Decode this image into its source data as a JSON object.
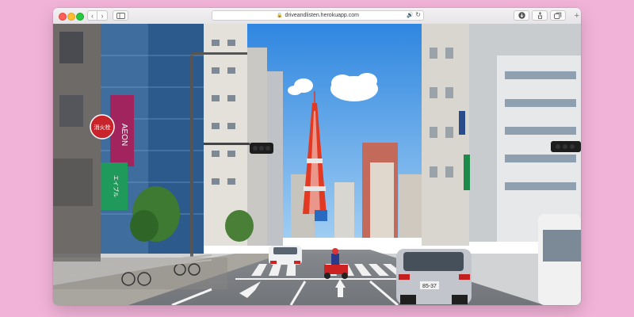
{
  "browser": {
    "url": "driveandlisten.herokuapp.com",
    "back_glyph": "‹",
    "forward_glyph": "›",
    "new_tab_glyph": "+"
  },
  "icons": [
    "close-icon",
    "minimize-icon",
    "zoom-icon",
    "back-icon",
    "forward-icon",
    "sidebar-icon",
    "lock-icon",
    "speaker-icon",
    "reload-icon",
    "download-icon",
    "share-icon",
    "tabs-icon",
    "add-tab-icon"
  ],
  "colors": {
    "page_background": "#f2b3d8",
    "sky": "#3f9ae8",
    "tower": "#e23a22"
  },
  "scene": {
    "sign_left_red": "消火栓",
    "sign_aeon": "AEON",
    "sign_green": "エイブル",
    "plate": "85-37"
  }
}
